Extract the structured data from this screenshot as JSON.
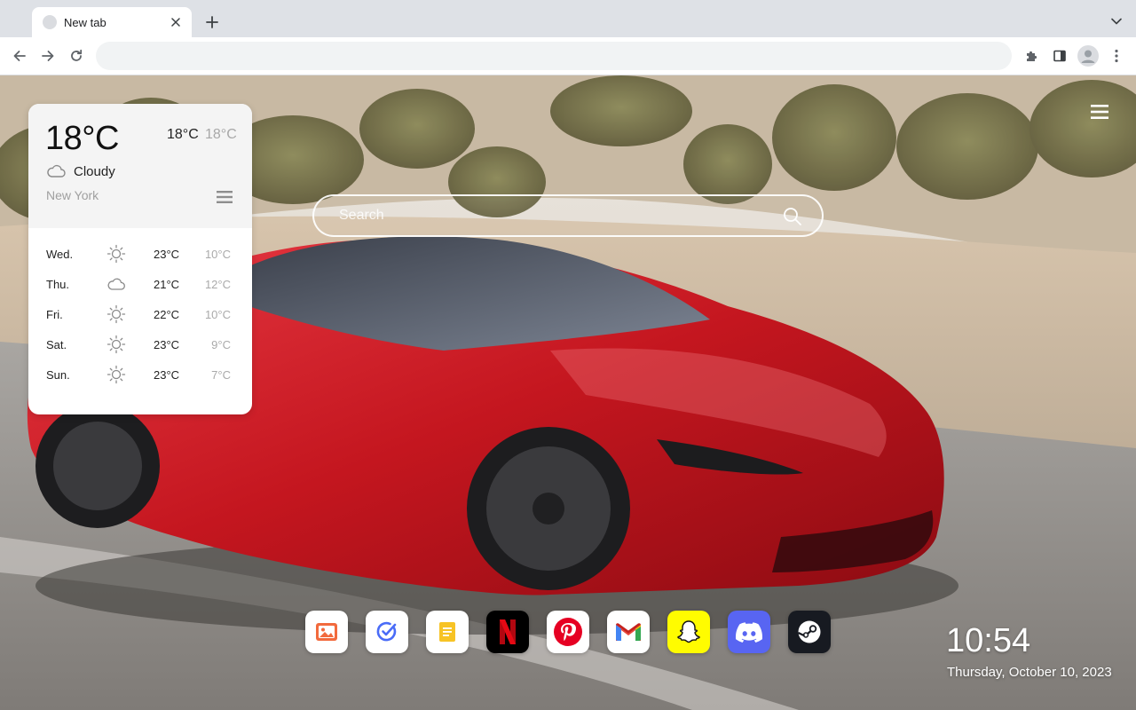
{
  "browser": {
    "tab_title": "New tab",
    "omnibox_value": ""
  },
  "weather": {
    "current_temp": "18°C",
    "high": "18°C",
    "low": "18°C",
    "condition": "Cloudy",
    "condition_icon": "cloud-icon",
    "city": "New York",
    "forecast": [
      {
        "day": "Wed.",
        "icon": "sun-icon",
        "high": "23°C",
        "low": "10°C"
      },
      {
        "day": "Thu.",
        "icon": "cloud-icon",
        "high": "21°C",
        "low": "12°C"
      },
      {
        "day": "Fri.",
        "icon": "sun-icon",
        "high": "22°C",
        "low": "10°C"
      },
      {
        "day": "Sat.",
        "icon": "sun-icon",
        "high": "23°C",
        "low": "9°C"
      },
      {
        "day": "Sun.",
        "icon": "sun-icon",
        "high": "23°C",
        "low": "7°C"
      }
    ]
  },
  "search": {
    "placeholder": "Search"
  },
  "shortcuts": [
    {
      "name": "photos",
      "icon": "image-icon",
      "bg": "#ffffff"
    },
    {
      "name": "tasks",
      "icon": "check-circle-icon",
      "bg": "#ffffff"
    },
    {
      "name": "notes",
      "icon": "note-icon",
      "bg": "#ffffff"
    },
    {
      "name": "netflix",
      "icon": "netflix-icon",
      "bg": "#000000"
    },
    {
      "name": "pinterest",
      "icon": "pinterest-icon",
      "bg": "#ffffff"
    },
    {
      "name": "gmail",
      "icon": "gmail-icon",
      "bg": "#ffffff"
    },
    {
      "name": "snapchat",
      "icon": "snapchat-icon",
      "bg": "#fffc00"
    },
    {
      "name": "discord",
      "icon": "discord-icon",
      "bg": "#5865f2"
    },
    {
      "name": "steam",
      "icon": "steam-icon",
      "bg": "#171a21"
    }
  ],
  "clock": {
    "time": "10:54",
    "date": "Thursday, October 10, 2023"
  }
}
